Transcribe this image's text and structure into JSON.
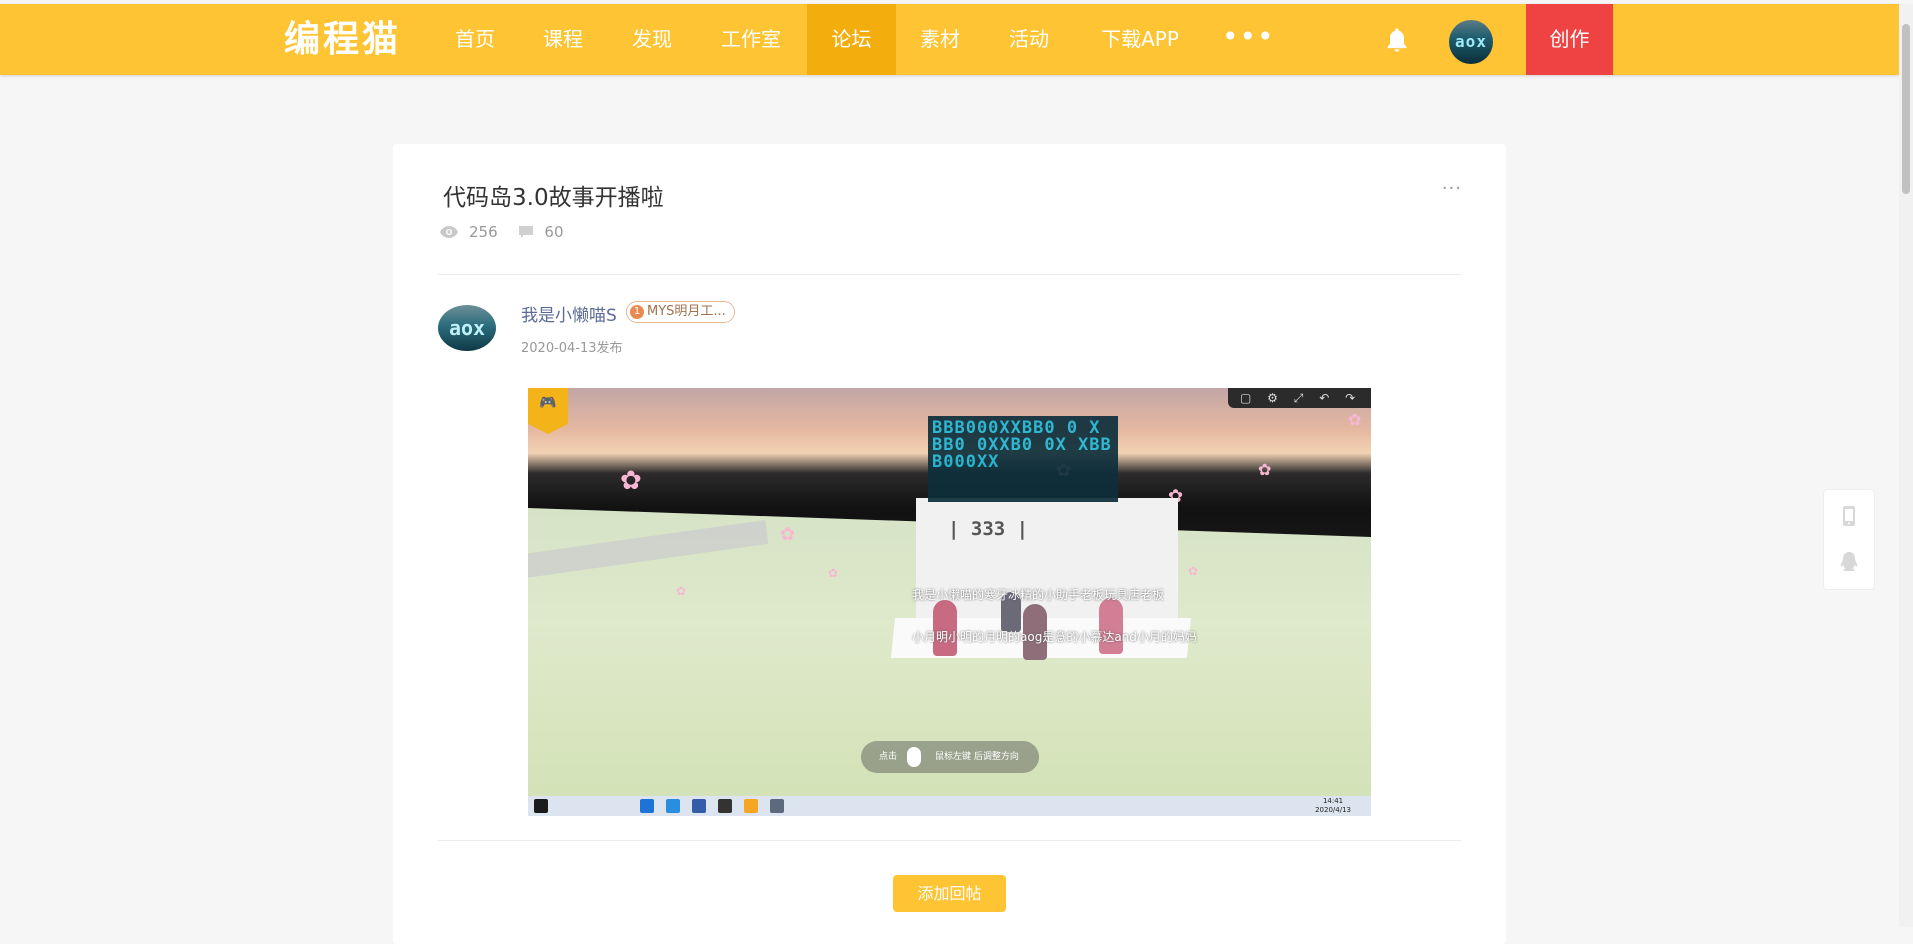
{
  "header": {
    "logo": "编程猫",
    "nav": [
      {
        "label": "首页",
        "active": false
      },
      {
        "label": "课程",
        "active": false
      },
      {
        "label": "发现",
        "active": false
      },
      {
        "label": "工作室",
        "active": false
      },
      {
        "label": "论坛",
        "active": true
      },
      {
        "label": "素材",
        "active": false
      },
      {
        "label": "活动",
        "active": false
      },
      {
        "label": "下载APP",
        "active": false
      }
    ],
    "more": "•••",
    "avatar_text": "aox",
    "create_label": "创作",
    "colors": {
      "bar": "#fec433",
      "active": "#f3ad0c",
      "create": "#ef4242"
    }
  },
  "post": {
    "title": "代码岛3.0故事开播啦",
    "more": "···",
    "views": "256",
    "comments": "60",
    "author": {
      "avatar_text": "aox",
      "name": "我是小懒喵S",
      "badge_level": "1",
      "badge_label": "MYS明月工..."
    },
    "date": "2020-04-13发布",
    "image": {
      "sign_top": "BBB000XXBB0 0 X BB0 0XXB0 0X XBBB000XX",
      "sign_mid": "| 333 |",
      "overlay_line1": "我是小懒喵的寒牙冰精的小助手老板玩具店老板",
      "overlay_line2": "小月明小明的月明的aog是意的小慕达and小月的妈妈",
      "hint_left": "点击",
      "hint_right": "鼠标左键 后调整方向",
      "clock_time": "14:41",
      "clock_date": "2020/4/13"
    },
    "reply_label": "添加回帖"
  }
}
